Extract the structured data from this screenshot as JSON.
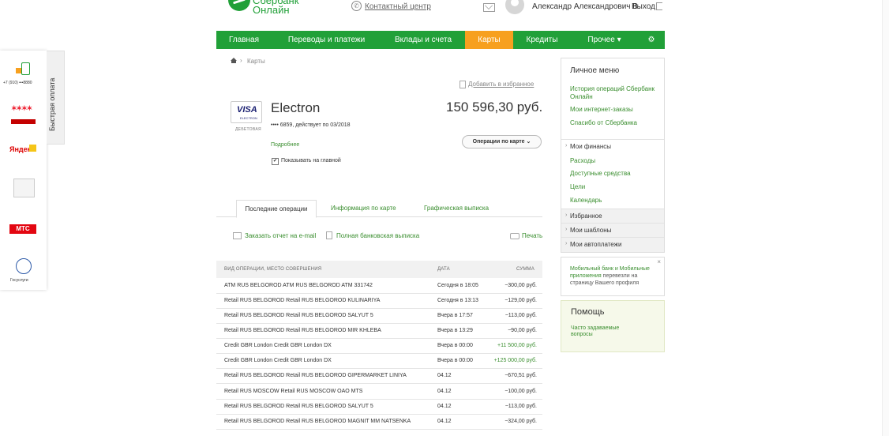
{
  "header": {
    "logo_line1": "Сбербанк",
    "logo_line2": "Онлайн",
    "contact_center": "Контактный центр",
    "user_name": "Александр Александрович В.",
    "logout": "Выход"
  },
  "nav": {
    "items": [
      {
        "label": "Главная"
      },
      {
        "label": "Переводы и платежи"
      },
      {
        "label": "Вклады и счета"
      },
      {
        "label": "Карты"
      },
      {
        "label": "Кредиты"
      },
      {
        "label": "Прочее ▾"
      },
      {
        "label": "⚙"
      }
    ]
  },
  "breadcrumb": {
    "current": "Карты"
  },
  "favorites": "Добавить в избранное",
  "card": {
    "brand": "VISA",
    "brand_sub": "ELECTRON",
    "type_label": "ДЕБЕТОВАЯ",
    "name": "Electron",
    "balance": "150 596,30 руб.",
    "number_info": "•••• 6859, действует по 03/2018",
    "details_link": "Подробнее",
    "operations_button": "Операции по карте ⌄",
    "show_on_main": "Показывать на главной",
    "show_on_main_checked": "✔"
  },
  "tabs": {
    "recent": "Последние операции",
    "info": "Информация по карте",
    "graphic": "Графическая выписка"
  },
  "actions": {
    "email_report": "Заказать отчет на e-mail",
    "full_statement": "Полная банковская выписка",
    "print": "Печать"
  },
  "table": {
    "headers": {
      "type": "ВИД ОПЕРАЦИИ, МЕСТО СОВЕРШЕНИЯ",
      "date": "ДАТА",
      "amount": "СУММА"
    },
    "rows": [
      {
        "desc": "ATM RUS BELGOROD ATM RUS BELGOROD ATM 331742",
        "date": "Сегодня в 18:05",
        "amount": "−300,00 руб."
      },
      {
        "desc": "Retail RUS BELGOROD Retail RUS BELGOROD KULINARIYA",
        "date": "Сегодня в 13:13",
        "amount": "−129,00 руб."
      },
      {
        "desc": "Retail RUS BELGOROD Retail RUS BELGOROD SALYUT 5",
        "date": "Вчера в 17:57",
        "amount": "−113,00 руб."
      },
      {
        "desc": "Retail RUS BELGOROD Retail RUS BELGOROD MIR KHLEBA",
        "date": "Вчера в 13:29",
        "amount": "−90,00 руб."
      },
      {
        "desc": "Credit GBR London Credit GBR London DX",
        "date": "Вчера в 00:00",
        "amount": "+11 500,00 руб."
      },
      {
        "desc": "Credit GBR London Credit GBR London DX",
        "date": "Вчера в 00:00",
        "amount": "+125 000,00 руб."
      },
      {
        "desc": "Retail RUS BELGOROD Retail RUS BELGOROD GIPERMARKET LINIYA",
        "date": "04.12",
        "amount": "−670,51 руб."
      },
      {
        "desc": "Retail RUS MOSCOW Retail RUS MOSCOW OAO MTS",
        "date": "04.12",
        "amount": "−100,00 руб."
      },
      {
        "desc": "Retail RUS BELGOROD Retail RUS BELGOROD SALYUT 5",
        "date": "04.12",
        "amount": "−113,00 руб."
      },
      {
        "desc": "Retail RUS BELGOROD Retail RUS BELGOROD MAGNIT MM NATSENKA",
        "date": "04.12",
        "amount": "−324,00 руб."
      }
    ]
  },
  "right_menu": {
    "title": "Личное меню",
    "links": [
      "История операций Сбербанк Онлайн",
      "Мои интернет-заказы",
      "Спасибо от Сбербанка"
    ],
    "finances": "Мои финансы",
    "finance_links": [
      "Расходы",
      "Доступные средства",
      "Цели",
      "Календарь"
    ],
    "sections": [
      "Избранное",
      "Мои шаблоны",
      "Мои автоплатежи"
    ]
  },
  "promo": {
    "text_link": "Мобильный банк и Мобильные приложения",
    "text_rest": " перевезли на страницу Вашего профиля",
    "close": "×"
  },
  "help": {
    "title": "Помощь",
    "faq": "Часто задаваемые вопросы"
  },
  "quick_pay": {
    "tab_label": "Быстрая оплата",
    "phone": "+7 (910) •••8880",
    "tricolor": "триколор",
    "yandex": "Яндекс",
    "mts": "МТС",
    "gosuslugi": "Госуслуги"
  }
}
